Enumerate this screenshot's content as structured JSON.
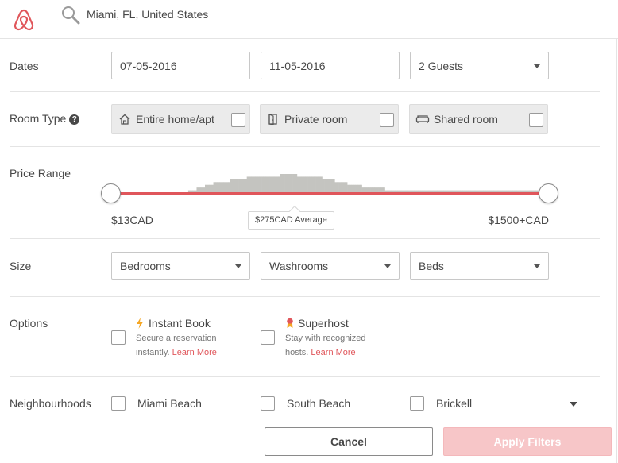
{
  "header": {
    "location": "Miami, FL, United States"
  },
  "dates": {
    "label": "Dates",
    "checkin": "07-05-2016",
    "checkout": "11-05-2016",
    "guests": "2 Guests"
  },
  "room_type": {
    "label": "Room Type",
    "help": "?",
    "options": [
      {
        "label": "Entire home/apt",
        "icon": "home-icon",
        "checked": false
      },
      {
        "label": "Private room",
        "icon": "door-icon",
        "checked": false
      },
      {
        "label": "Shared room",
        "icon": "couch-icon",
        "checked": false
      }
    ]
  },
  "price": {
    "label": "Price Range",
    "min_label": "$13CAD",
    "max_label": "$1500+CAD",
    "average_label": "$275CAD Average",
    "histogram": [
      0,
      0,
      0,
      0,
      0,
      0,
      0,
      0,
      0,
      0,
      0,
      0,
      0,
      0,
      0,
      0,
      0,
      0,
      0,
      0,
      0,
      0,
      0,
      0,
      0,
      0,
      0,
      0,
      0,
      0,
      0,
      0,
      0,
      1,
      1,
      1,
      1,
      2,
      2,
      2,
      2,
      3,
      3,
      3,
      3,
      4,
      4,
      4,
      4,
      4,
      4,
      4,
      4,
      5,
      5,
      5,
      5,
      5,
      5,
      5,
      5,
      6,
      6,
      6,
      6,
      6,
      6,
      6,
      6,
      6,
      6,
      6,
      6,
      6,
      6,
      6,
      6,
      7,
      7,
      7,
      7,
      7,
      7,
      7,
      7,
      6,
      6,
      6,
      6,
      6,
      6,
      6,
      6,
      6,
      6,
      6,
      6,
      5,
      5,
      5,
      5,
      5,
      5,
      4,
      4,
      4,
      4,
      4,
      4,
      3,
      3,
      3,
      3,
      3,
      3,
      3,
      2,
      2,
      2,
      2,
      2,
      2,
      2,
      2,
      2,
      2,
      2,
      1,
      1,
      1,
      1,
      1,
      1,
      1,
      1,
      1,
      1,
      1,
      1,
      1,
      1,
      1,
      1,
      1,
      1,
      1,
      1,
      1,
      1,
      1,
      1,
      1,
      1,
      1,
      1,
      1,
      1,
      1,
      1,
      1,
      1,
      1,
      1,
      1,
      1,
      1,
      1,
      1,
      1,
      1,
      1,
      1,
      1,
      1,
      1,
      1,
      1,
      1,
      1,
      1,
      1,
      1,
      1,
      1,
      1,
      1,
      1,
      1,
      1,
      1,
      1,
      1,
      1,
      1,
      1,
      1,
      1,
      1,
      1,
      1,
      1,
      1,
      1,
      3,
      3
    ],
    "accent": "#e0565b"
  },
  "size": {
    "label": "Size",
    "bedrooms": "Bedrooms",
    "washrooms": "Washrooms",
    "beds": "Beds"
  },
  "options": {
    "label": "Options",
    "instant_book": {
      "title": "Instant Book",
      "desc": "Secure a reservation instantly.",
      "link": "Learn More",
      "icon": "lightning-icon"
    },
    "superhost": {
      "title": "Superhost",
      "desc": "Stay with recognized hosts.",
      "link": "Learn More",
      "icon": "superhost-badge-icon"
    }
  },
  "neighbourhoods": {
    "label": "Neighbourhoods",
    "items": [
      "Miami Beach",
      "South Beach",
      "Brickell"
    ]
  },
  "buttons": {
    "cancel": "Cancel",
    "apply": "Apply Filters"
  }
}
